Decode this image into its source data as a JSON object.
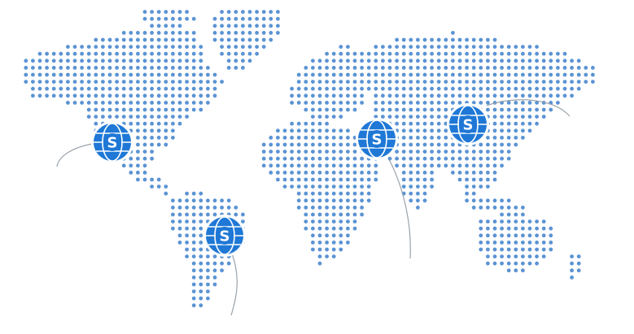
{
  "map": {
    "dot_color": "#5b93d3",
    "marker_color": "#1f78d6",
    "arc_color": "#9aa3ab",
    "markers": [
      {
        "name": "north-america",
        "label": "S",
        "icon": "globe-s-icon"
      },
      {
        "name": "south-america",
        "label": "S",
        "icon": "globe-s-icon"
      },
      {
        "name": "central-asia",
        "label": "S",
        "icon": "globe-s-icon"
      },
      {
        "name": "east-asia",
        "label": "S",
        "icon": "globe-s-icon"
      }
    ]
  }
}
